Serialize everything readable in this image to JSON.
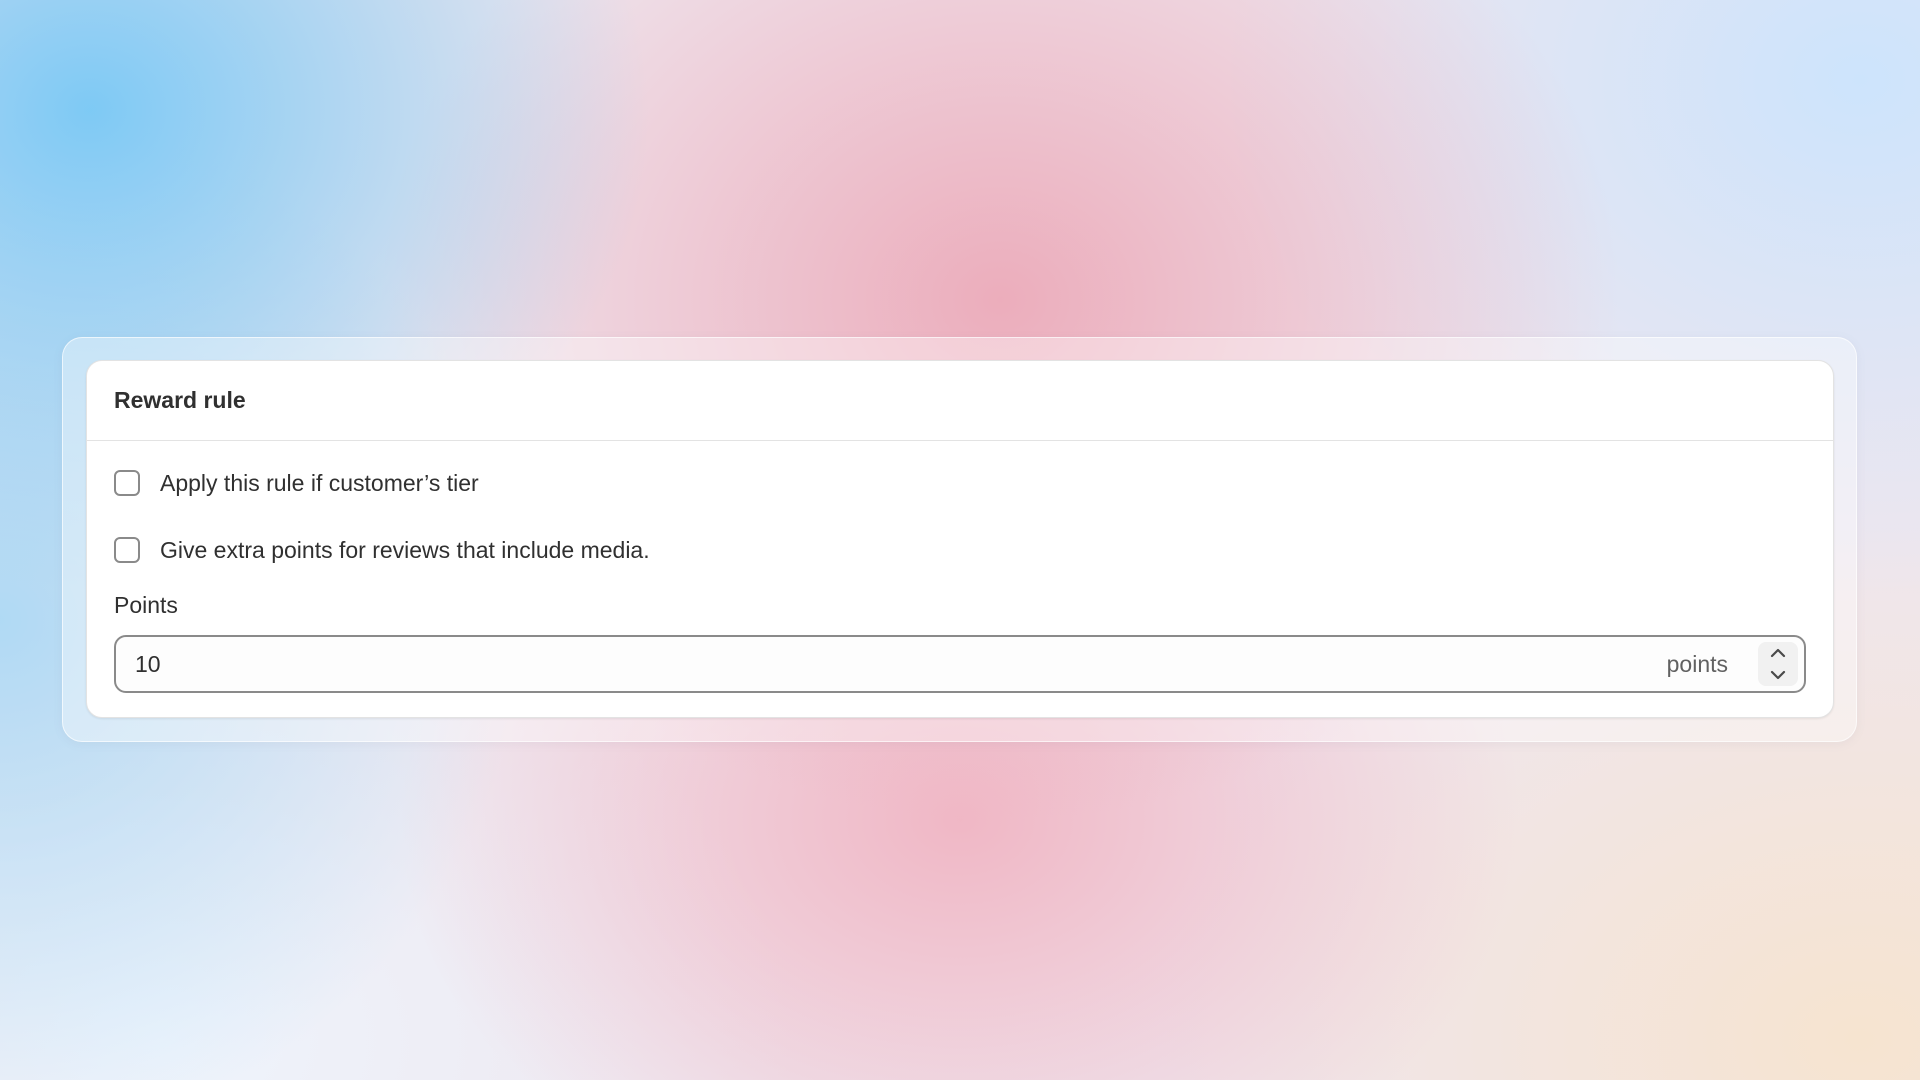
{
  "card": {
    "title": "Reward rule",
    "options": [
      {
        "label": "Apply this rule if customer’s tier",
        "checked": false
      },
      {
        "label": "Give extra points for reviews that include media.",
        "checked": false
      }
    ],
    "points_field": {
      "label": "Points",
      "value": "10",
      "suffix": "points"
    }
  },
  "icons": {
    "increment": "chevron-up-icon",
    "decrement": "chevron-down-icon"
  },
  "colors": {
    "text": "#303030",
    "muted": "#616161",
    "border": "#8a8a8a",
    "divider": "#e3e3e3",
    "surface": "#ffffff"
  }
}
